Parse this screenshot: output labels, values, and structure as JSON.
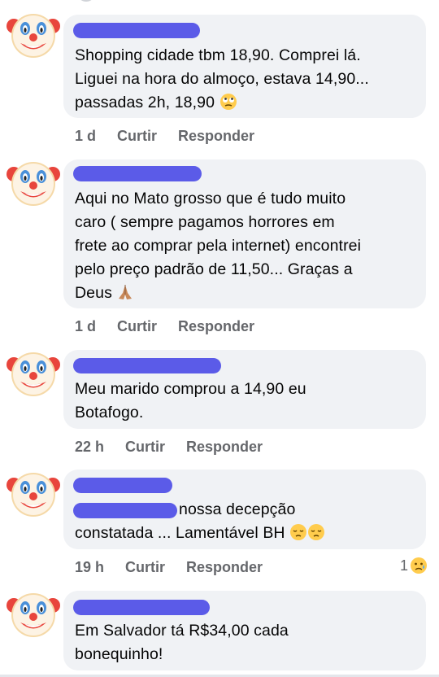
{
  "comments": [
    {
      "text_lines": [
        "Shopping cidade tbm 18,90. Comprei lá.",
        "Liguei na hora do almoço, estava 14,90...",
        "passadas 2h, 18,90"
      ],
      "trailing_emoji": "rolling-eyes-emoji",
      "time": "1 d",
      "like": "Curtir",
      "reply": "Responder"
    },
    {
      "text_lines": [
        "Aqui no Mato grosso que é tudo muito",
        "caro ( sempre pagamos horrores em",
        "frete ao comprar pela internet) encontrei",
        "pelo preço padrão de 11,50... Graças a",
        "Deus"
      ],
      "trailing_emoji": "praying-hands-emoji",
      "time": "1 d",
      "like": "Curtir",
      "reply": "Responder"
    },
    {
      "text_lines": [
        "Meu marido comprou a 14,90 eu",
        "Botafogo."
      ],
      "time": "22 h",
      "like": "Curtir",
      "reply": "Responder"
    },
    {
      "text_lines": [
        "nossa decepção",
        "constatada ... Lamentável BH"
      ],
      "trailing_emoji": "pensive-face-emoji",
      "time": "19 h",
      "like": "Curtir",
      "reply": "Responder",
      "reaction_count": "1",
      "reaction_emoji": "sad-tear-emoji"
    },
    {
      "text_lines": [
        "Em Salvador tá R$34,00 cada",
        "bonequinho!"
      ]
    }
  ],
  "colors": {
    "bubble": "#f0f2f5",
    "redaction": "#5b5be8",
    "meta_text": "#65676b"
  },
  "avatar_icon": "clown-face-emoji"
}
